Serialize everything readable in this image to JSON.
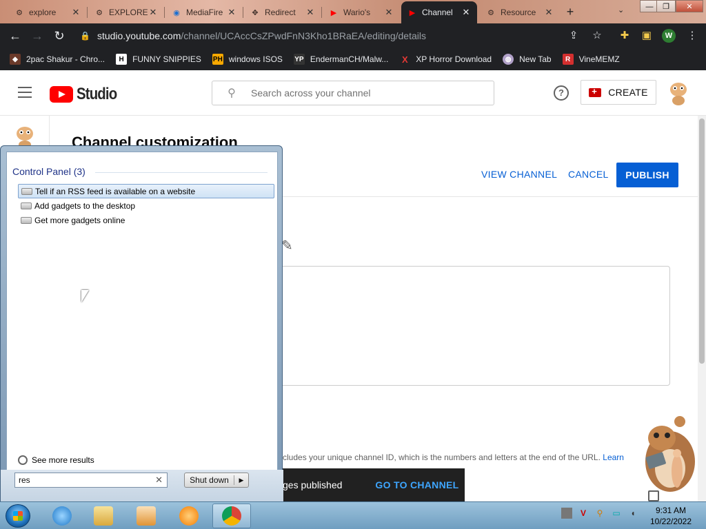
{
  "browser": {
    "tabs": [
      {
        "title": "explore",
        "favicon": "gear-icon"
      },
      {
        "title": "EXPLORE",
        "favicon": "gear-icon"
      },
      {
        "title": "MediaFire",
        "favicon": "mediafire-icon"
      },
      {
        "title": "Redirect",
        "favicon": "move-icon"
      },
      {
        "title": "Wario's",
        "favicon": "youtube-icon"
      },
      {
        "title": "Channel",
        "favicon": "youtube-icon",
        "active": true
      },
      {
        "title": "Resource",
        "favicon": "gear-icon"
      }
    ],
    "url_host": "studio.youtube.com",
    "url_path": "/channel/UCAccCsZPwdFnN3Kho1BRaEA/editing/details",
    "profile_initial": "W",
    "bookmarks": [
      {
        "label": "2pac Shakur - Chro...",
        "icon": "bookmark-icon"
      },
      {
        "label": "FUNNY SNIPPIES",
        "icon": "h-icon"
      },
      {
        "label": "windows ISOS",
        "icon": "ph-icon"
      },
      {
        "label": "EndermanCH/Malw...",
        "icon": "yp-icon"
      },
      {
        "label": "XP Horror Download",
        "icon": "x-icon"
      },
      {
        "label": "New Tab",
        "icon": "globe-icon"
      },
      {
        "label": "VineMEMZ",
        "icon": "r-icon"
      }
    ]
  },
  "studio": {
    "search_placeholder": "Search across your channel",
    "create_label": "CREATE",
    "page_title": "Channel customization",
    "view_channel_label": "VIEW CHANNEL",
    "cancel_label": "CANCEL",
    "publish_label": "PUBLISH",
    "url_help_text": "cludes your unique channel ID, which is the numbers and letters at the end of the URL.",
    "url_help_link": "Learn",
    "snackbar_message": "ges published",
    "snackbar_action": "GO TO CHANNEL"
  },
  "start_menu": {
    "group_header": "Control Panel (3)",
    "results": [
      "Tell if an RSS feed is available on a website",
      "Add gadgets to the desktop",
      "Get more gadgets online"
    ],
    "see_more": "See more results",
    "search_value": "res",
    "shutdown_label": "Shut down"
  },
  "taskbar": {
    "time": "9:31 AM",
    "date": "10/22/2022"
  },
  "colors": {
    "youtube_red": "#ff0000",
    "studio_blue": "#065fd4",
    "snackbar_bg": "#212121"
  }
}
